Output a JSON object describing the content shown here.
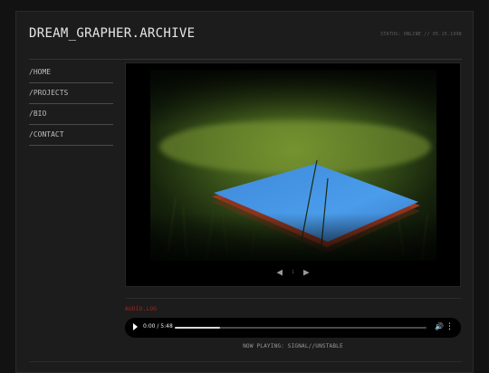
{
  "site": {
    "title": "DREAM_GRAPHER.ARCHIVE",
    "status": "STATUS: ONLINE // 05.15.1998"
  },
  "nav": {
    "items": [
      {
        "label": "/HOME"
      },
      {
        "label": "/PROJECTS"
      },
      {
        "label": "/BIO"
      },
      {
        "label": "/CONTACT"
      }
    ]
  },
  "gallery": {
    "prev_icon": "◀",
    "next_icon": "▶",
    "page_indicator": "1",
    "photo_subject": "blue-book-in-grass"
  },
  "audio": {
    "label": "AUDIO.LOG",
    "time": "0:00 / 5:48",
    "progress": 0.18,
    "volume_icon": "🔊",
    "more_icon": "⋮",
    "now_playing": "NOW PLAYING: SIGNAL//UNSTABLE"
  },
  "colors": {
    "background": "#121212",
    "panel": "#1c1c1c",
    "accent_red": "#b02020",
    "book_blue": "#3a8fe0"
  }
}
